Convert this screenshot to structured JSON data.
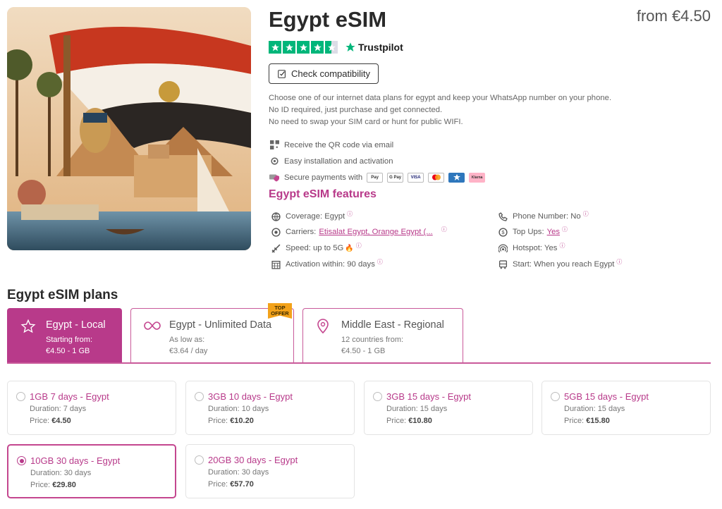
{
  "product": {
    "title": "Egypt eSIM",
    "price_from": "from €4.50",
    "rating_stars": 4.5,
    "trustpilot_label": "Trustpilot",
    "check_compat_label": "Check compatibility"
  },
  "description": [
    "Choose one of our internet data plans for egypt and keep your WhatsApp number on your phone.",
    "No ID required, just purchase and get connected.",
    "No need to swap your SIM card or hunt for public WIFI."
  ],
  "perks": {
    "qr": "Receive the QR code via email",
    "install": "Easy installation and activation",
    "secure": "Secure payments with"
  },
  "payments": [
    "Pay",
    "G Pay",
    "VISA",
    "MC",
    "AX",
    "Klarna"
  ],
  "features": {
    "title": "Egypt eSIM features",
    "coverage": "Coverage: Egypt",
    "carriers_label": "Carriers:",
    "carriers_link": "Etisalat Egypt, Orange Egypt (...",
    "speed": "Speed: up to 5G",
    "activation": "Activation within: 90 days",
    "phone": "Phone Number: No",
    "topups_label": "Top Ups:",
    "topups_link": "Yes",
    "hotspot": "Hotspot: Yes",
    "start": "Start: When you reach Egypt"
  },
  "plans": {
    "title": "Egypt eSIM plans",
    "badge": "TOP OFFER",
    "tabs": [
      {
        "name": "Egypt - Local",
        "sub1": "Starting from:",
        "sub2": "€4.50 - 1 GB"
      },
      {
        "name": "Egypt - Unlimited Data",
        "sub1": "As low as:",
        "sub2": "€3.64 / day"
      },
      {
        "name": "Middle East - Regional",
        "sub1": "12 countries from:",
        "sub2": "€4.50 - 1 GB"
      }
    ],
    "cards": [
      {
        "name": "1GB 7 days - Egypt",
        "duration": "Duration: 7 days",
        "price_label": "Price:",
        "price": "€4.50"
      },
      {
        "name": "3GB 10 days - Egypt",
        "duration": "Duration: 10 days",
        "price_label": "Price:",
        "price": "€10.20"
      },
      {
        "name": "3GB 15 days - Egypt",
        "duration": "Duration: 15 days",
        "price_label": "Price:",
        "price": "€10.80"
      },
      {
        "name": "5GB 15 days - Egypt",
        "duration": "Duration: 15 days",
        "price_label": "Price:",
        "price": "€15.80"
      },
      {
        "name": "10GB 30 days - Egypt",
        "duration": "Duration: 30 days",
        "price_label": "Price:",
        "price": "€29.80"
      },
      {
        "name": "20GB 30 days - Egypt",
        "duration": "Duration: 30 days",
        "price_label": "Price:",
        "price": "€57.70"
      }
    ],
    "selected_index": 4
  },
  "colors": {
    "accent": "#b83a8a",
    "trustpilot_green": "#00b67a",
    "badge": "#f3a21a"
  }
}
